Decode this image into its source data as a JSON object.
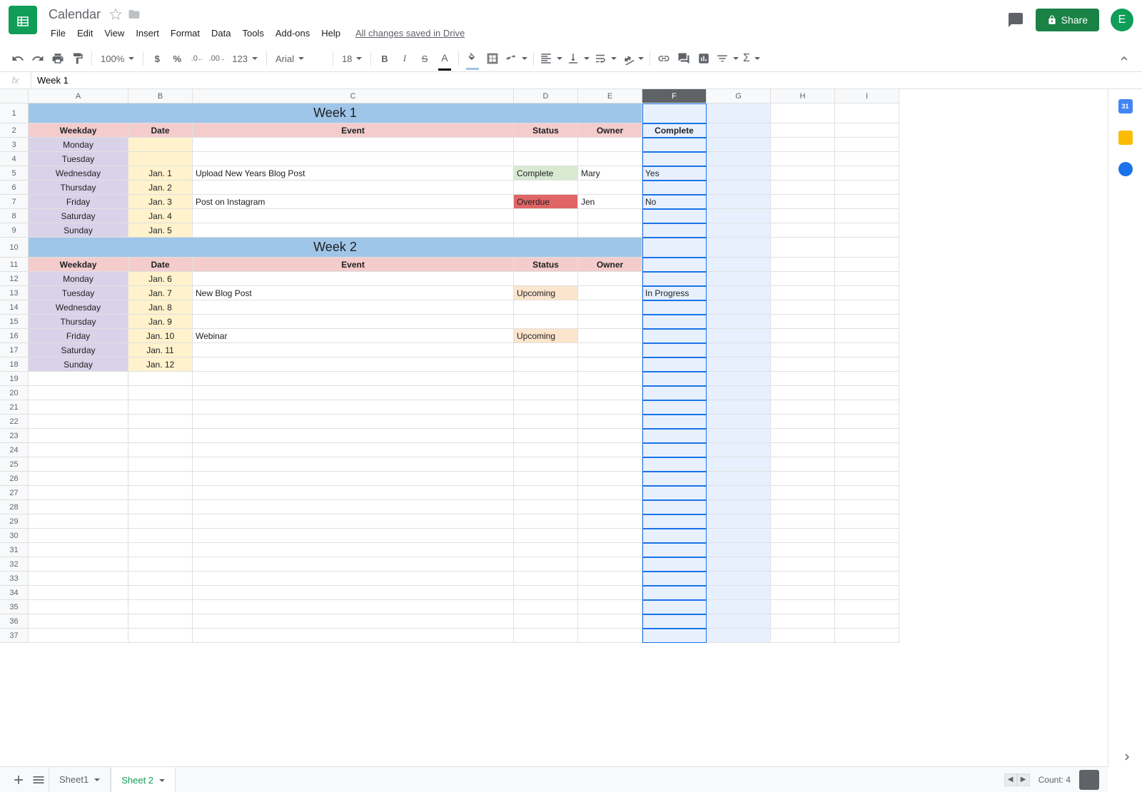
{
  "doc": {
    "title": "Calendar",
    "save_status": "All changes saved in Drive",
    "avatar_initial": "E"
  },
  "menu": [
    "File",
    "Edit",
    "View",
    "Insert",
    "Format",
    "Data",
    "Tools",
    "Add-ons",
    "Help"
  ],
  "share_label": "Share",
  "toolbar": {
    "zoom": "100%",
    "format_123": "123",
    "font": "Arial",
    "font_size": "18"
  },
  "formula": {
    "fx": "fx",
    "value": "Week 1"
  },
  "columns": [
    "A",
    "B",
    "C",
    "D",
    "E",
    "F",
    "G",
    "H",
    "I"
  ],
  "selected_column": "F",
  "row_count": 37,
  "weeks": [
    {
      "title": "Week 1",
      "headers": [
        "Weekday",
        "Date",
        "Event",
        "Status",
        "Owner",
        "Complete"
      ],
      "rows": [
        {
          "weekday": "Monday",
          "date": "",
          "event": "",
          "status": "",
          "status_class": "",
          "owner": "",
          "complete": ""
        },
        {
          "weekday": "Tuesday",
          "date": "",
          "event": "",
          "status": "",
          "status_class": "",
          "owner": "",
          "complete": ""
        },
        {
          "weekday": "Wednesday",
          "date": "Jan. 1",
          "event": "Upload New Years Blog Post",
          "status": "Complete",
          "status_class": "status-complete",
          "owner": "Mary",
          "complete": "Yes"
        },
        {
          "weekday": "Thursday",
          "date": "Jan. 2",
          "event": "",
          "status": "",
          "status_class": "",
          "owner": "",
          "complete": ""
        },
        {
          "weekday": "Friday",
          "date": "Jan. 3",
          "event": "Post on Instagram",
          "status": "Overdue",
          "status_class": "status-overdue",
          "owner": "Jen",
          "complete": "No"
        },
        {
          "weekday": "Saturday",
          "date": "Jan. 4",
          "event": "",
          "status": "",
          "status_class": "",
          "owner": "",
          "complete": ""
        },
        {
          "weekday": "Sunday",
          "date": "Jan. 5",
          "event": "",
          "status": "",
          "status_class": "",
          "owner": "",
          "complete": ""
        }
      ]
    },
    {
      "title": "Week 2",
      "headers": [
        "Weekday",
        "Date",
        "Event",
        "Status",
        "Owner",
        ""
      ],
      "rows": [
        {
          "weekday": "Monday",
          "date": "Jan. 6",
          "event": "",
          "status": "",
          "status_class": "",
          "owner": "",
          "complete": ""
        },
        {
          "weekday": "Tuesday",
          "date": "Jan. 7",
          "event": "New Blog Post",
          "status": "Upcoming",
          "status_class": "status-upcoming",
          "owner": "",
          "complete": "In Progress"
        },
        {
          "weekday": "Wednesday",
          "date": "Jan. 8",
          "event": "",
          "status": "",
          "status_class": "",
          "owner": "",
          "complete": ""
        },
        {
          "weekday": "Thursday",
          "date": "Jan. 9",
          "event": "",
          "status": "",
          "status_class": "",
          "owner": "",
          "complete": ""
        },
        {
          "weekday": "Friday",
          "date": "Jan. 10",
          "event": "Webinar",
          "status": "Upcoming",
          "status_class": "status-upcoming",
          "owner": "",
          "complete": ""
        },
        {
          "weekday": "Saturday",
          "date": "Jan. 11",
          "event": "",
          "status": "",
          "status_class": "",
          "owner": "",
          "complete": ""
        },
        {
          "weekday": "Sunday",
          "date": "Jan. 12",
          "event": "",
          "status": "",
          "status_class": "",
          "owner": "",
          "complete": ""
        }
      ]
    }
  ],
  "tabs": [
    {
      "name": "Sheet1",
      "active": false
    },
    {
      "name": "Sheet 2",
      "active": true
    }
  ],
  "footer_count": "Count: 4",
  "side_cal_day": "31"
}
